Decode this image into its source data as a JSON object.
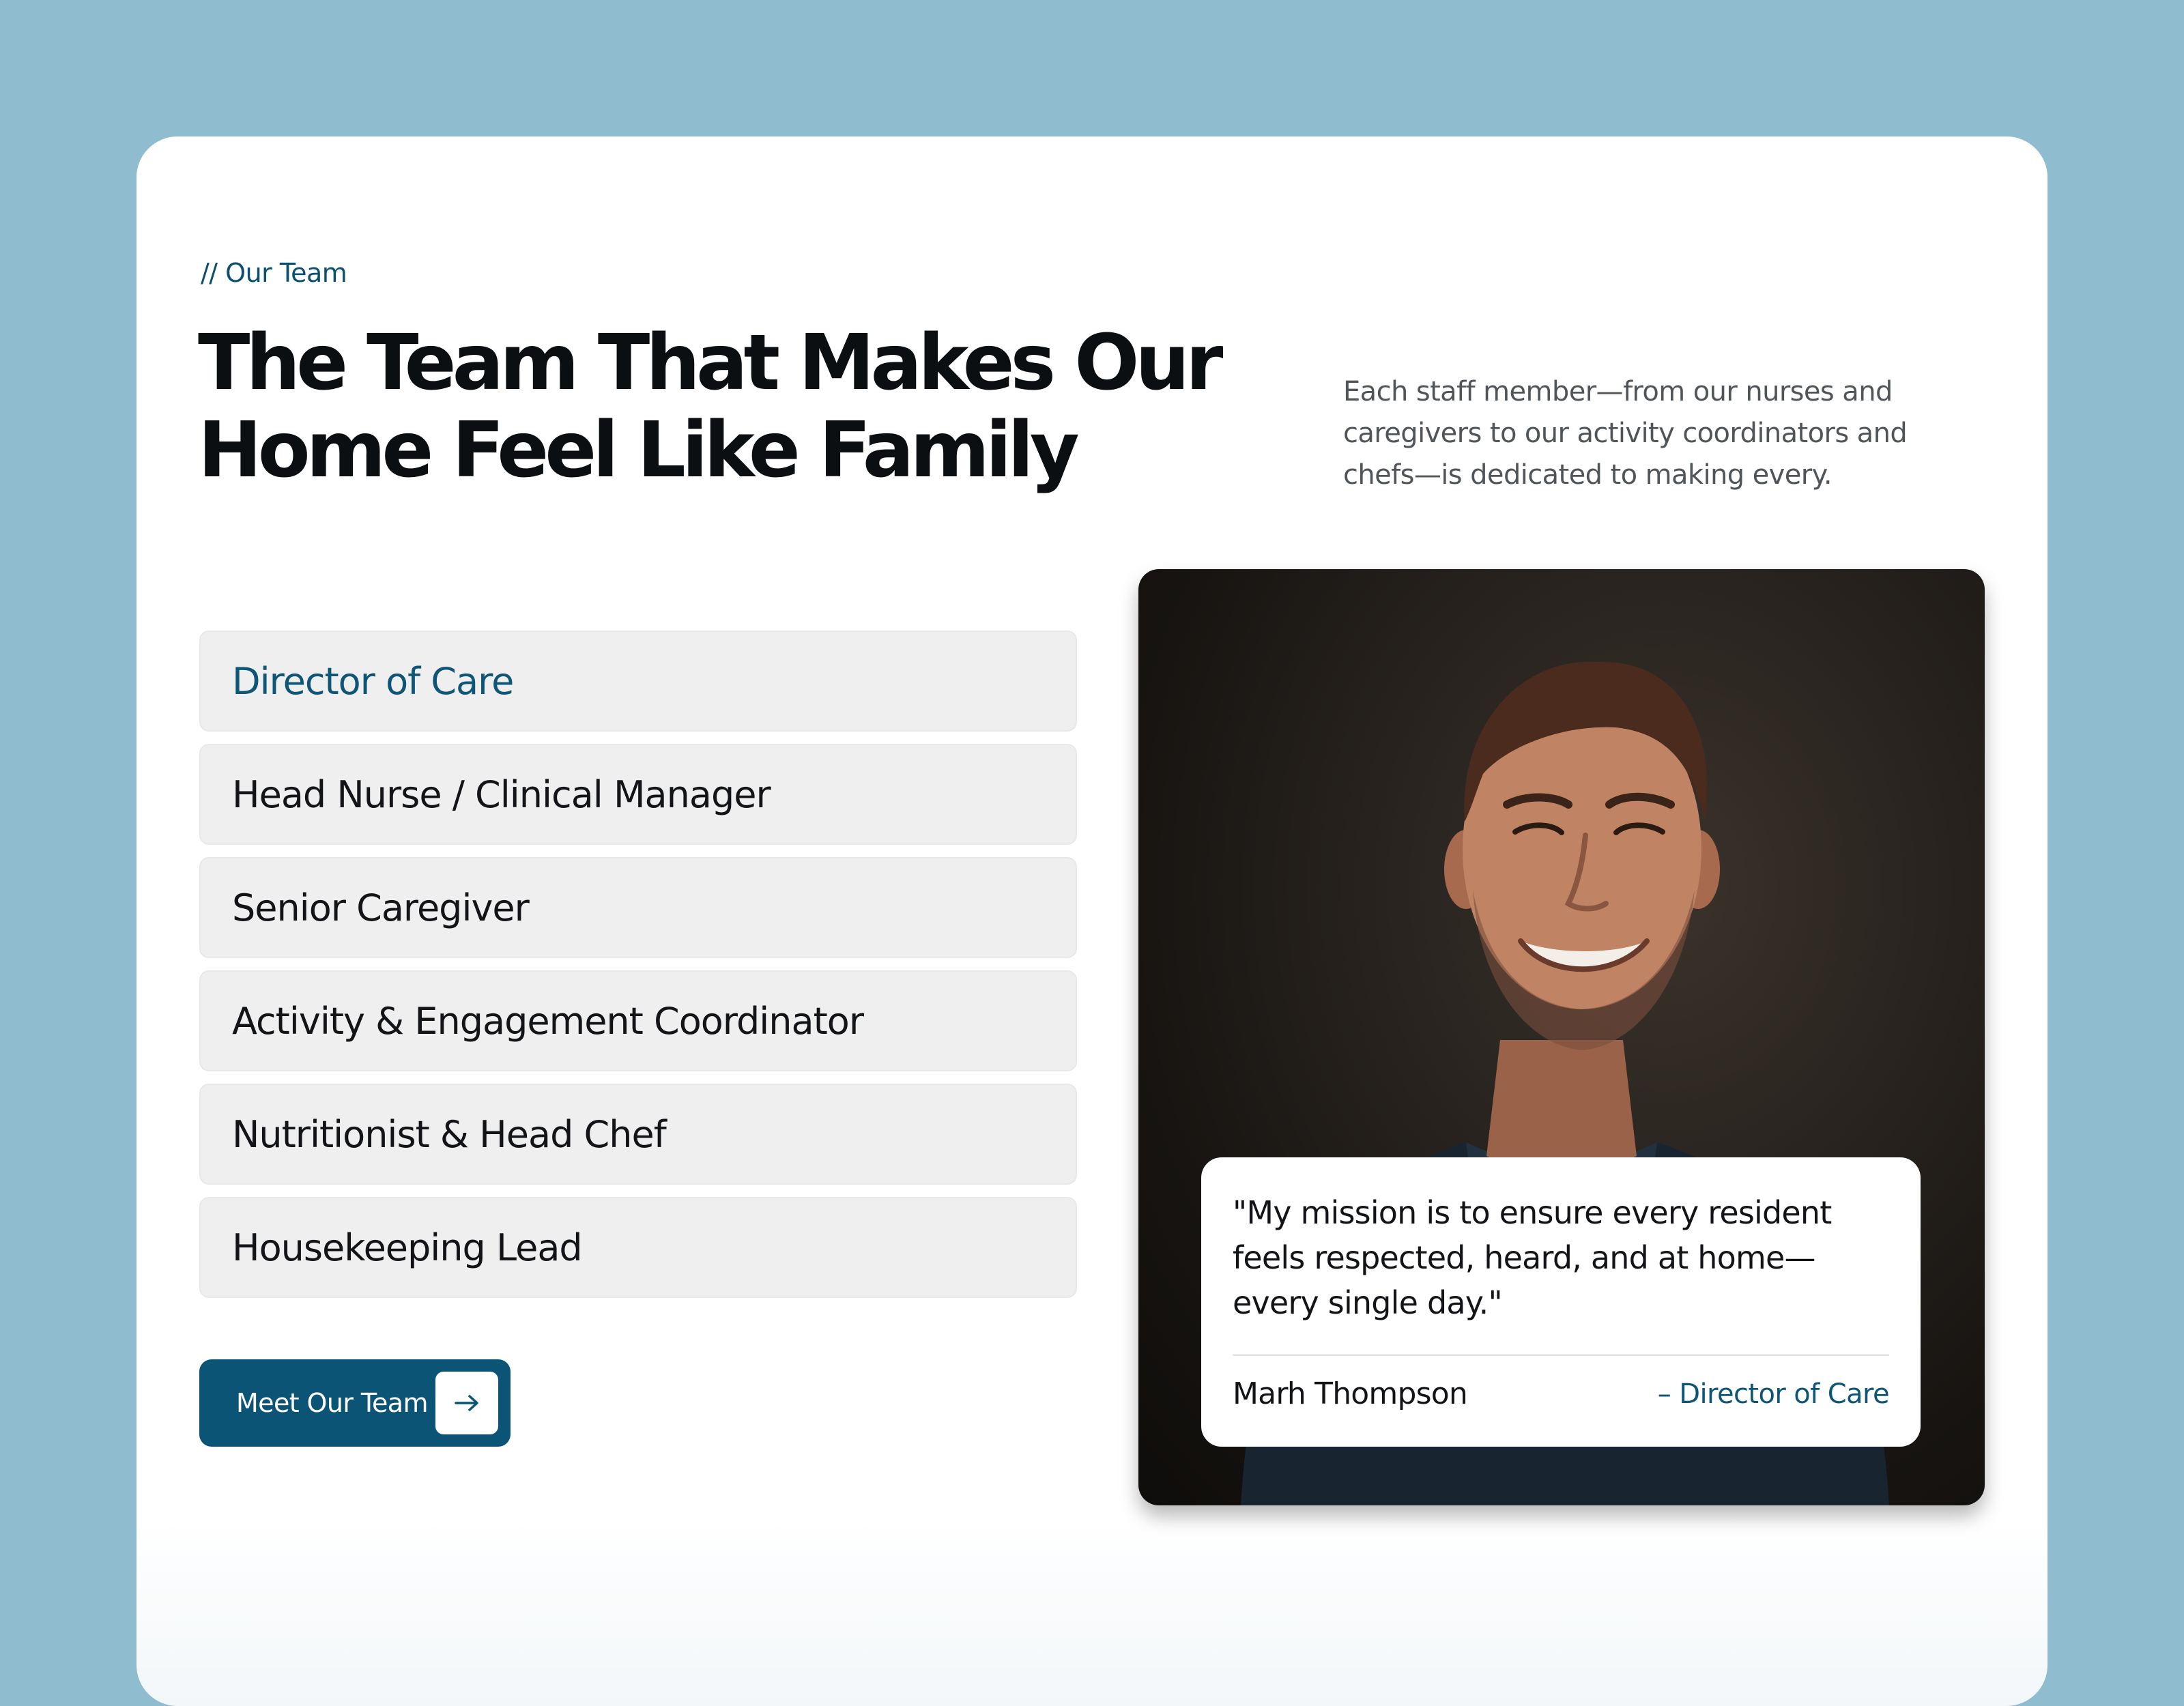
{
  "section": {
    "eyebrow": "// Our Team",
    "headline_line1": "The Team That Makes Our",
    "headline_line2": "Home Feel Like Family",
    "intro": "Each staff member—from our nurses and caregivers to our activity coordinators and chefs—is dedicated to making every."
  },
  "roles": [
    {
      "label": "Director of Care",
      "active": true
    },
    {
      "label": "Head Nurse / Clinical Manager",
      "active": false
    },
    {
      "label": "Senior Caregiver",
      "active": false
    },
    {
      "label": "Activity & Engagement Coordinator",
      "active": false
    },
    {
      "label": "Nutritionist & Head Chef",
      "active": false
    },
    {
      "label": "Housekeeping Lead",
      "active": false
    }
  ],
  "cta": {
    "label": "Meet Our Team",
    "icon": "arrow-right-icon"
  },
  "feature": {
    "photo": "portrait-photo",
    "quote": "\"My mission is to ensure every resident feels respected, heard, and at home—every single day.\"",
    "name": "Marh Thompson",
    "role": "– Director of Care"
  },
  "colors": {
    "page_background": "#8fbccf",
    "card_background": "#ffffff",
    "accent": "#0c5476",
    "active_text": "#0e5577",
    "role_background": "#efefef",
    "heading_text": "#0c0f12",
    "body_text": "#50555a"
  }
}
